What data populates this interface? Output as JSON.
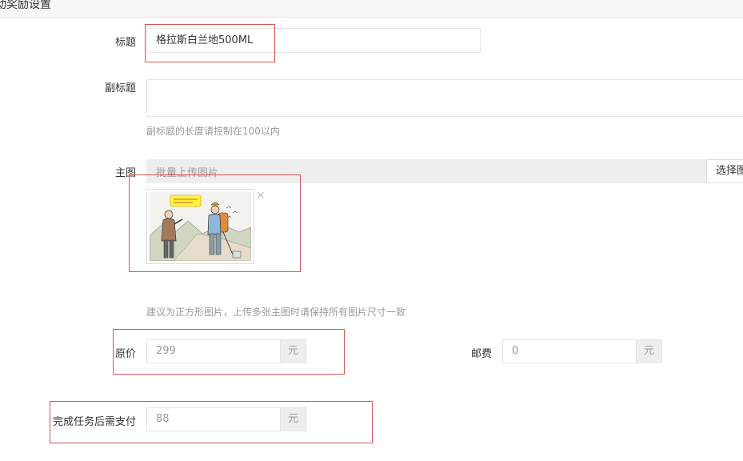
{
  "section_title": "动奖励设置",
  "form": {
    "title_label": "标题",
    "title_value": "格拉斯白兰地500ML",
    "subtitle_label": "副标题",
    "subtitle_value": "",
    "subtitle_help": "副标题的长度请控制在100以内",
    "main_image_label": "主图",
    "main_image_placeholder": "批量上传图片",
    "main_image_button": "选择图",
    "main_image_remove": "×",
    "main_image_help": "建议为正方形图片，上传多张主图时请保持所有图片尺寸一致",
    "original_price_label": "原价",
    "original_price_value": "299",
    "original_price_unit": "元",
    "shipping_label": "邮费",
    "shipping_value": "0",
    "shipping_unit": "元",
    "pay_after_task_label": "完成任务后需支付",
    "pay_after_task_value": "88",
    "pay_after_task_unit": "元"
  },
  "colors": {
    "highlight_border": "#d9534f",
    "input_border": "#e5e5e5",
    "addon_bg": "#eeeeee",
    "help_text": "#999999"
  }
}
